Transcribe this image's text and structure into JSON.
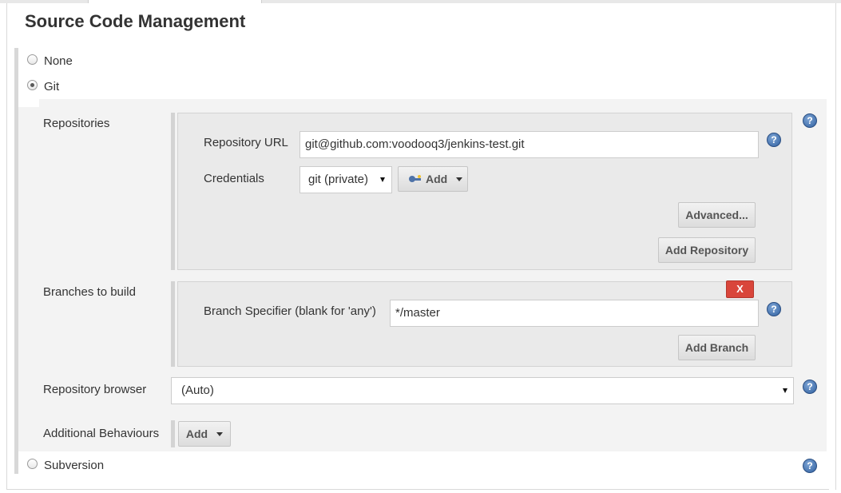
{
  "section": {
    "title": "Source Code Management"
  },
  "scm_options": [
    {
      "label": "None",
      "selected": false
    },
    {
      "label": "Git",
      "selected": true
    },
    {
      "label": "Subversion",
      "selected": false
    }
  ],
  "git": {
    "repositories": {
      "label": "Repositories",
      "url_label": "Repository URL",
      "url_value": "git@github.com:voodooq3/jenkins-test.git",
      "credentials_label": "Credentials",
      "credentials_value": "git (private)",
      "add_label": "Add",
      "advanced_label": "Advanced...",
      "add_repository_label": "Add Repository"
    },
    "branches": {
      "label": "Branches to build",
      "delete_label": "X",
      "specifier_label": "Branch Specifier (blank for 'any')",
      "specifier_value": "*/master",
      "add_branch_label": "Add Branch"
    },
    "repository_browser": {
      "label": "Repository browser",
      "value": "(Auto)"
    },
    "additional_behaviours": {
      "label": "Additional Behaviours",
      "add_label": "Add"
    }
  },
  "help_glyph": "?",
  "icons": {
    "help": "help-icon",
    "credentials": "key-icon",
    "dropdown": "caret-down-icon"
  },
  "colors": {
    "delete_button": "#d9463b",
    "help_icon": "#2f5f9f",
    "panel_background": "#f3f3f3"
  }
}
